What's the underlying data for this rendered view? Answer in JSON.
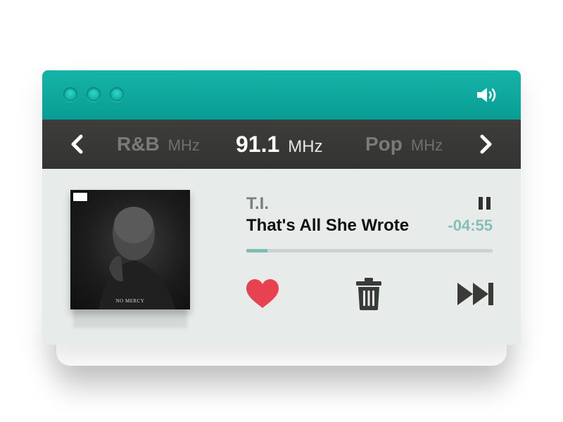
{
  "window": {
    "controls": [
      "traffic-dot-1",
      "traffic-dot-2",
      "traffic-dot-3"
    ],
    "volume_icon": "volume-icon"
  },
  "stations": {
    "prev_icon": "chevron-left-icon",
    "next_icon": "chevron-right-icon",
    "left": {
      "name": "R&B",
      "unit": "MHz"
    },
    "current": {
      "name": "91.1",
      "unit": "MHz"
    },
    "right": {
      "name": "Pop",
      "unit": "MHz"
    }
  },
  "now_playing": {
    "artist": "T.I.",
    "title": "That's All She Wrote",
    "remaining": "-04:55",
    "progress": 0.085,
    "album_title": "NO MERCY",
    "pause_icon": "pause-icon"
  },
  "controls": {
    "like_icon": "heart-icon",
    "delete_icon": "trash-icon",
    "skip_icon": "skip-next-icon"
  },
  "colors": {
    "accent": "#0ba89e",
    "station_bar": "#383937",
    "heart": "#e8414f",
    "time": "#86bfb8",
    "body": "#e7ebe9"
  }
}
